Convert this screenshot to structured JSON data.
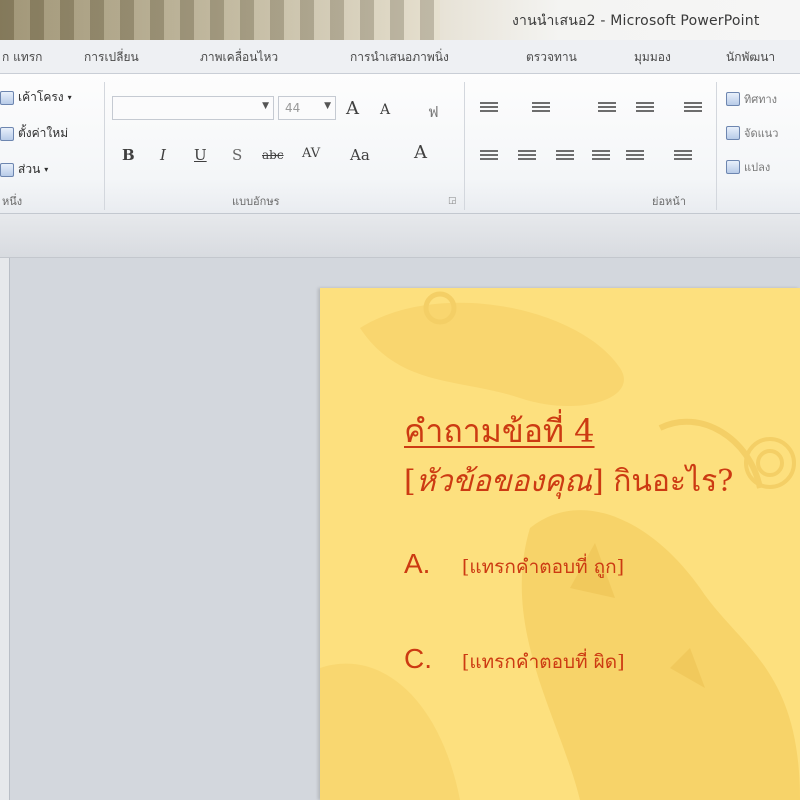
{
  "window": {
    "title": "งานนำเสนอ2  -  Microsoft PowerPoint"
  },
  "tabs": [
    {
      "label": "ก แทรก"
    },
    {
      "label": "การเปลี่ยน"
    },
    {
      "label": "ภาพเคลื่อนไหว"
    },
    {
      "label": "การนำเสนอภาพนิ่ง"
    },
    {
      "label": "ตรวจทาน"
    },
    {
      "label": "มุมมอง"
    },
    {
      "label": "นักพัฒนา"
    }
  ],
  "ribbon": {
    "slides_group": {
      "layout_label": "เค้าโครง",
      "reset_label": "ตั้งค่าใหม่",
      "section_label": "ส่วน",
      "group_label": "หนึ่ง"
    },
    "font_group": {
      "font_name": "",
      "font_size": "44",
      "grow_font": "A",
      "shrink_font": "A",
      "clear_format": "ฟ",
      "bold": "B",
      "italic": "I",
      "underline": "U",
      "shadow": "S",
      "strikethrough": "abc",
      "char_spacing": "AV",
      "change_case": "Aa",
      "font_color": "A",
      "group_label": "แบบอักษร"
    },
    "paragraph_group": {
      "group_label": "ย่อหน้า"
    },
    "drawing_group": {
      "text_direction_label": "ทิศทาง",
      "align_text_label": "จัดแนว",
      "convert_smartart_label": "แปลง"
    }
  },
  "slide": {
    "title": "คำถามข้อที่ 4",
    "question_bracket_open": "[",
    "question_placeholder": "หัวข้อของคุณ",
    "question_bracket_close": "]",
    "question_suffix": " กินอะไร?",
    "answers": [
      {
        "letter": "A.",
        "text": "[แทรกคำตอบที่ ถูก]"
      },
      {
        "letter": "C.",
        "text": "[แทรกคำตอบที่ ผิด]"
      }
    ]
  },
  "colors": {
    "slide_background": "#fde07e",
    "slide_text": "#cc3a12",
    "ribbon_background": "#f4f6f8",
    "workspace_background": "#d3d7dd"
  }
}
